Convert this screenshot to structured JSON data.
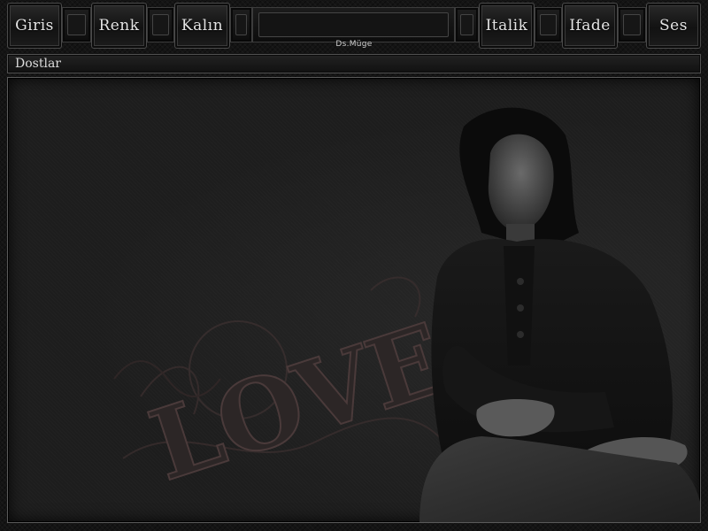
{
  "toolbar": {
    "buttons": [
      {
        "id": "giris",
        "label": "Giris"
      },
      {
        "id": "renk",
        "label": "Renk"
      },
      {
        "id": "kalin",
        "label": "Kalın"
      },
      {
        "id": "italik",
        "label": "Italik"
      },
      {
        "id": "ifade",
        "label": "Ifade"
      },
      {
        "id": "ses",
        "label": "Ses"
      }
    ],
    "credit": "Ds.Müge"
  },
  "tab_bar": {
    "label": "Dostlar"
  },
  "main": {
    "art_text": "LOVE"
  },
  "colors": {
    "background": "#141414",
    "border": "#5a5a5a",
    "text": "#e4e4e4"
  }
}
